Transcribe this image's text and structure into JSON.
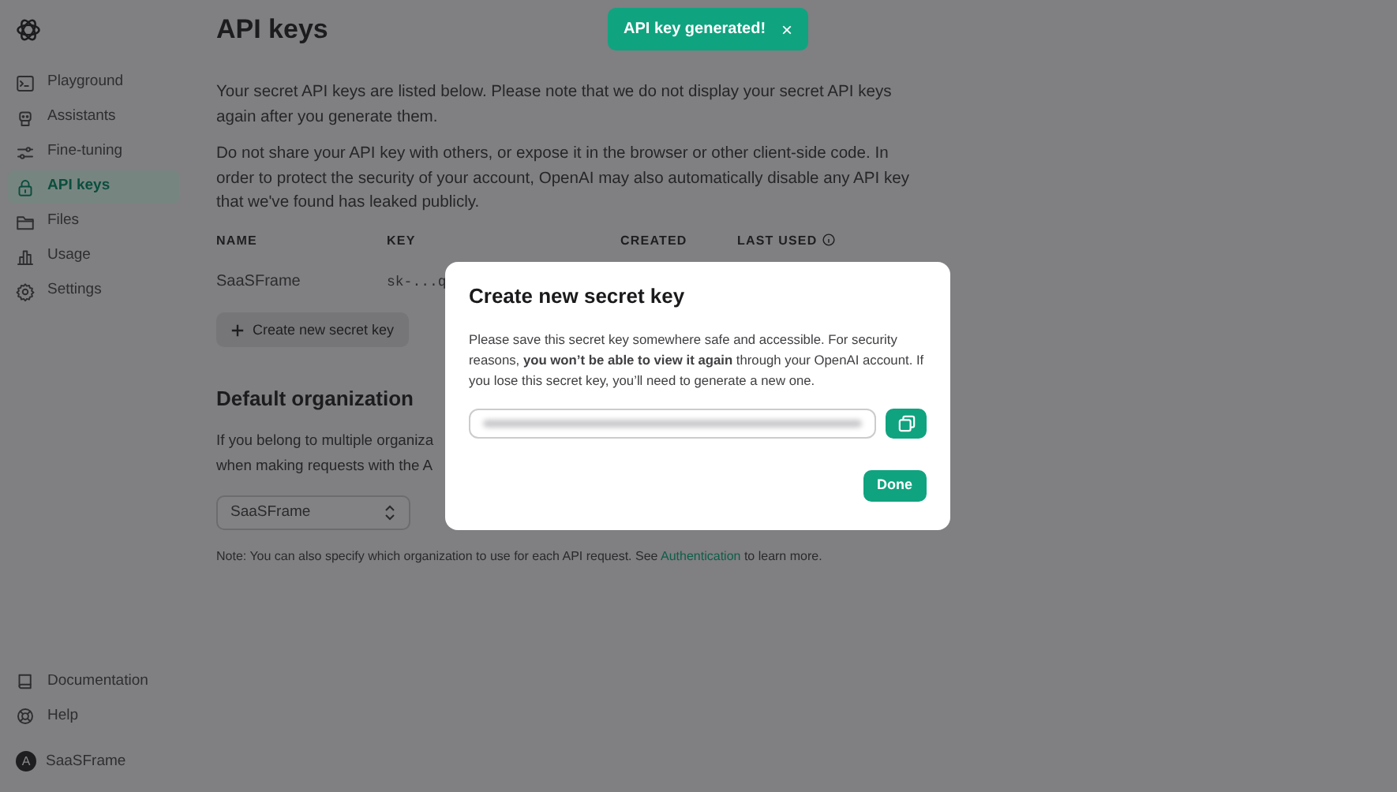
{
  "toast": {
    "text": "API key generated!",
    "close": "×"
  },
  "sidebar": {
    "items": [
      {
        "label": "Playground",
        "selected": false
      },
      {
        "label": "Assistants",
        "selected": false
      },
      {
        "label": "Fine-tuning",
        "selected": false
      },
      {
        "label": "API keys",
        "selected": true
      },
      {
        "label": "Files",
        "selected": false
      },
      {
        "label": "Usage",
        "selected": false
      },
      {
        "label": "Settings",
        "selected": false
      }
    ],
    "footer_items": [
      {
        "label": "Documentation"
      },
      {
        "label": "Help"
      }
    ],
    "account": {
      "initial": "A",
      "name": "SaaSFrame"
    }
  },
  "page": {
    "title": "API keys",
    "paragraphs": [
      "Your secret API keys are listed below. Please note that we do not display your secret API keys again after you generate them.",
      "Do not share your API key with others, or expose it in the browser or other client-side code. In order to protect the security of your account, OpenAI may also automatically disable any API key that we've found has leaked publicly."
    ],
    "table": {
      "columns": [
        {
          "label": "NAME",
          "info": false
        },
        {
          "label": "KEY",
          "info": false
        },
        {
          "label": "CREATED",
          "info": false
        },
        {
          "label": "LAST USED",
          "info": true
        }
      ],
      "rows": [
        [
          "SaaSFrame",
          "sk-...q"
        ]
      ]
    },
    "create_button": "Create new secret key",
    "org": {
      "heading": "Default organization",
      "text_lines": [
        "If you belong to multiple organiza",
        "when making requests with the A"
      ],
      "select_value": "SaaSFrame",
      "note_before": "Note: You can also specify which organization to use for each API request. See",
      "note_link": "Authentication",
      "note_after": "to learn more."
    }
  },
  "dialog": {
    "title": "Create new secret key",
    "body": "Please save this secret key somewhere safe and accessible. For security reasons, **you won’t be able to view it again** through your OpenAI account. If you lose this secret key, you’ll need to generate a new one.",
    "done_button": "Done"
  }
}
